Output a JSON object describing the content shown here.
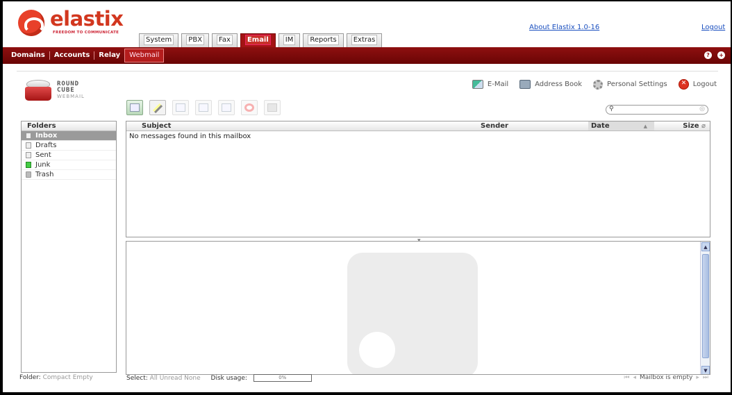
{
  "brand": {
    "name": "elastix",
    "tagline": "FREEDOM TO COMMUNICATE"
  },
  "main_tabs": [
    {
      "label": "System"
    },
    {
      "label": "PBX"
    },
    {
      "label": "Fax"
    },
    {
      "label": "Email",
      "active": true
    },
    {
      "label": "IM"
    },
    {
      "label": "Reports"
    },
    {
      "label": "Extras"
    }
  ],
  "top_links": {
    "about": "About Elastix 1.0-16",
    "logout": "Logout"
  },
  "module_bar": {
    "items": [
      "Domains",
      "Accounts",
      "Relay",
      "Webmail"
    ],
    "active": "Webmail",
    "icons": [
      "help-icon",
      "add-icon"
    ]
  },
  "roundcube": {
    "logo_line1": "ROUND",
    "logo_line2": "CUBE",
    "logo_line3": "WEBMAIL",
    "taskbar": {
      "email": "E-Mail",
      "address_book": "Address Book",
      "settings": "Personal Settings",
      "logout": "Logout"
    },
    "toolbar_buttons": [
      "check-mail-icon",
      "compose-icon",
      "reply-icon",
      "reply-all-icon",
      "forward-icon",
      "delete-icon",
      "print-icon"
    ],
    "search": {
      "placeholder": "",
      "icon": "search-icon"
    },
    "folders_header": "Folders",
    "folders": [
      {
        "name": "Inbox",
        "selected": true
      },
      {
        "name": "Drafts"
      },
      {
        "name": "Sent"
      },
      {
        "name": "Junk"
      },
      {
        "name": "Trash"
      }
    ],
    "list": {
      "columns": {
        "subject": "Subject",
        "sender": "Sender",
        "date": "Date",
        "size": "Size"
      },
      "empty_message": "No messages found in this mailbox"
    },
    "footer": {
      "folder_label": "Folder:",
      "compact": "Compact",
      "empty": "Empty",
      "select_label": "Select:",
      "all": "All",
      "unread": "Unread",
      "none": "None",
      "disk_label": "Disk usage:",
      "disk_value": "0%",
      "mailbox_status": "Mailbox is empty"
    }
  },
  "colors": {
    "accent": "#8e1010",
    "brand_red": "#d2371f",
    "link": "#1a4fbf"
  }
}
